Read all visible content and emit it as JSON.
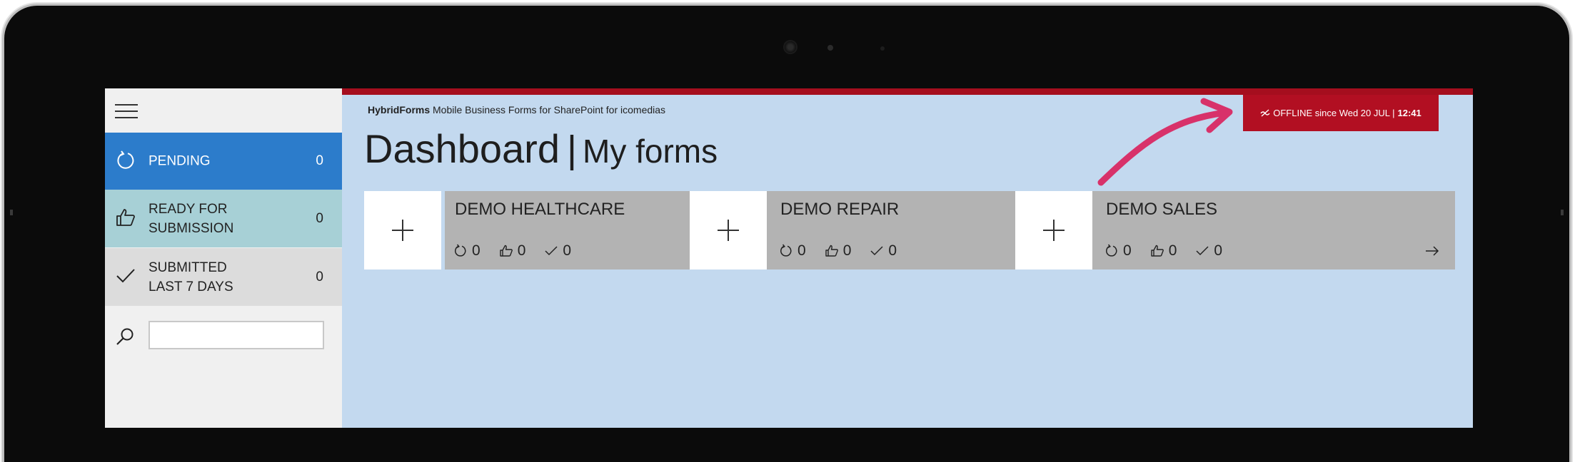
{
  "app": {
    "brand": "HybridForms",
    "tagline": "Mobile Business Forms for SharePoint for icomedias"
  },
  "status": {
    "offline_text": "OFFLINE since Wed 20 JUL |",
    "offline_time": "12:41",
    "icon": "offline-icon",
    "color": "#b20f22"
  },
  "page": {
    "title": "Dashboard",
    "separator": "|",
    "subtitle": "My forms"
  },
  "sidebar": {
    "items": [
      {
        "label": "PENDING",
        "count": "0",
        "icon": "refresh-icon"
      },
      {
        "label": "READY FOR\nSUBMISSION",
        "count": "0",
        "icon": "thumbs-up-icon"
      },
      {
        "label": "SUBMITTED\nLAST 7 DAYS",
        "count": "0",
        "icon": "checkmark-icon"
      }
    ],
    "search": {
      "value": "",
      "placeholder": ""
    }
  },
  "forms": [
    {
      "title": "DEMO HEALTHCARE",
      "pending": "0",
      "ready": "0",
      "submitted": "0"
    },
    {
      "title": "DEMO REPAIR",
      "pending": "0",
      "ready": "0",
      "submitted": "0"
    },
    {
      "title": "DEMO SALES",
      "pending": "0",
      "ready": "0",
      "submitted": "0"
    }
  ],
  "colors": {
    "accent_red": "#a50e1e",
    "pending_blue": "#2c7ccb",
    "ready_teal": "#a7d0d6",
    "submitted_gray": "#dcdcdc",
    "main_bg": "#c3d9ef",
    "card_gray": "#b3b3b3",
    "annotation_arrow": "#d8326a"
  }
}
